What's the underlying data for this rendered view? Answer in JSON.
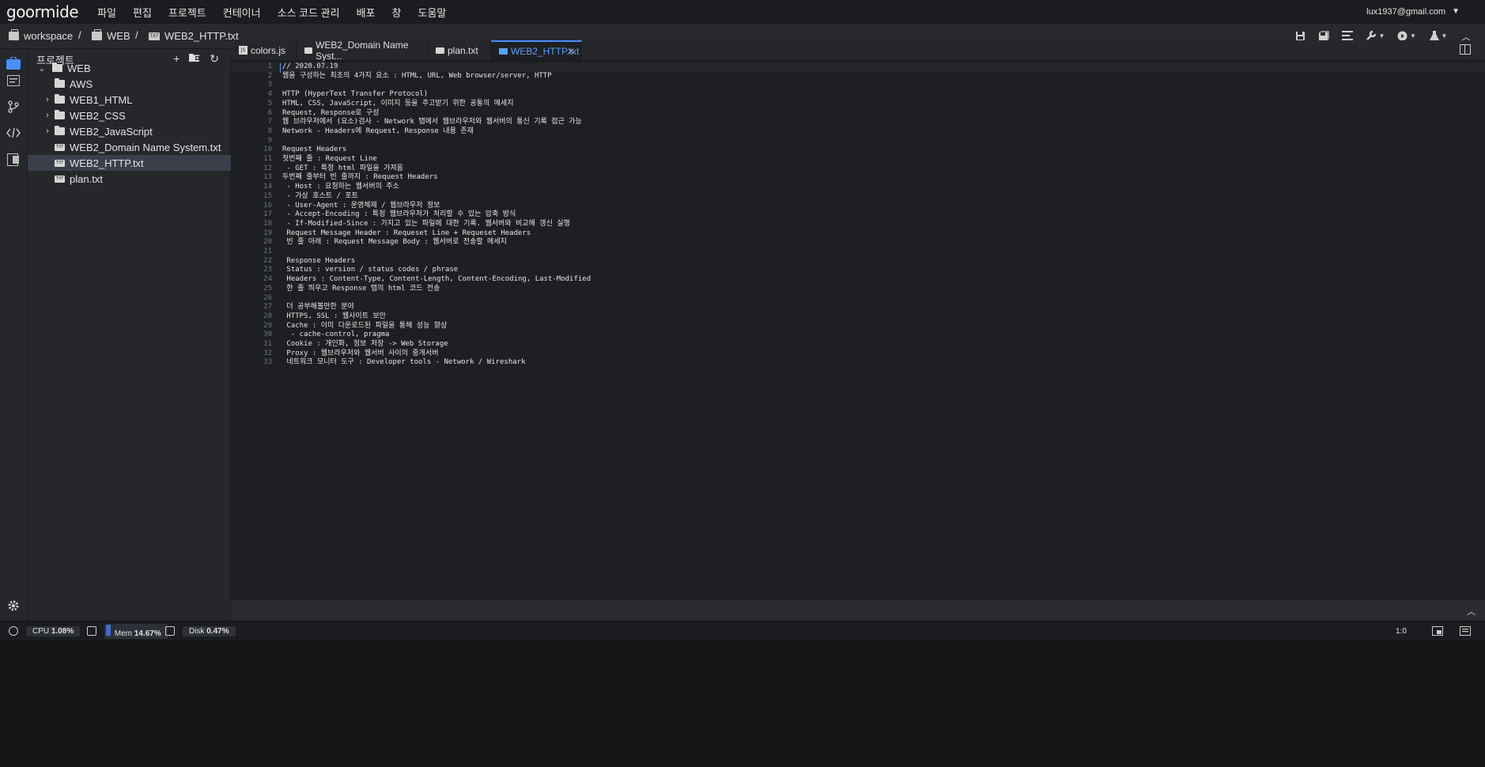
{
  "menubar": {
    "logo": "goormide",
    "items": [
      "파일",
      "편집",
      "프로젝트",
      "컨테이너",
      "소스 코드 관리",
      "배포",
      "창",
      "도움말"
    ],
    "user": "lux1937@gmail.com"
  },
  "breadcrumb": {
    "items": [
      "workspace",
      "WEB",
      "WEB2_HTTP.txt"
    ],
    "separator": "/"
  },
  "sidebar": {
    "title": "프로젝트",
    "tree": [
      {
        "label": "WEB",
        "type": "folder",
        "expanded": true
      },
      {
        "label": "AWS",
        "type": "folder"
      },
      {
        "label": "WEB1_HTML",
        "type": "folder"
      },
      {
        "label": "WEB2_CSS",
        "type": "folder"
      },
      {
        "label": "WEB2_JavaScript",
        "type": "folder"
      },
      {
        "label": "WEB2_Domain Name System.txt",
        "type": "file"
      },
      {
        "label": "WEB2_HTTP.txt",
        "type": "file",
        "selected": true
      },
      {
        "label": "plan.txt",
        "type": "file"
      }
    ]
  },
  "tabs": [
    {
      "label": "colors.js",
      "icon": "js-file-icon"
    },
    {
      "label": "WEB2_Domain Name Syst...",
      "icon": "txt-file-icon"
    },
    {
      "label": "plan.txt",
      "icon": "txt-file-icon"
    },
    {
      "label": "WEB2_HTTP.txt",
      "icon": "txt-file-icon",
      "active": true
    }
  ],
  "editor": {
    "lines": [
      "// 2020.07.19",
      "웹을 구성하는 최초의 4가지 요소 : HTML, URL, Web browser/server, HTTP",
      "",
      "HTTP (HyperText Transfer Protocol)",
      "HTML, CSS, JavaScript, 이미지 등을 주고받기 위한 공통의 메세지",
      "Request, Response로 구성",
      "웹 브라우저에서 (요소)검사 - Network 탭에서 웹브라우저와 웹서버의 통신 기록 접근 가능",
      "Network - Headers에 Request, Response 내용 존재",
      "",
      "Request Headers",
      "첫번째 줄 : Request Line",
      " - GET : 특정 html 파일을 가져옴",
      "두번째 줄부터 빈 줄까지 : Request Headers",
      " - Host : 요청하는 웹서버의 주소",
      " - 가상 호스트 / 포트",
      " - User-Agent : 운영체제 / 웹브라우저 정보",
      " - Accept-Encoding : 특정 웹브라우저가 처리할 수 있는 압축 방식",
      " - If-Modified-Since : 가지고 있는 파일에 대한 기록. 웹서버와 비교해 갱신 실행",
      " Request Message Header : Requeset Line + Requeset Headers",
      " 빈 줄 아래 : Request Message Body : 웹서버로 전송할 메세지",
      "",
      " Response Headers",
      " Status : version / status codes / phrase",
      " Headers : Content-Type, Content-Length, Content-Encoding, Last-Modified",
      " 한 줄 띄우고 Response 탭의 html 코드 전송",
      "",
      " 더 공부해볼만한 분야",
      " HTTPS, SSL : 웹사이트 보안",
      " Cache : 이미 다운로드된 파일을 통해 성능 향상",
      "  - cache-control, pragma",
      " Cookie : 개인화, 정보 저장 -> Web Storage",
      " Proxy : 웹브라우저와 웹서버 사이의 중개서버",
      " 네트워크 모니터 도구 : Developer tools - Network / Wireshark"
    ]
  },
  "statusbar": {
    "cpu_label": "CPU",
    "cpu_value": "1.08%",
    "mem_label": "Mem",
    "mem_value": "14.67%",
    "disk_label": "Disk",
    "disk_value": "0.47%",
    "cursor_pos": "1:0"
  }
}
